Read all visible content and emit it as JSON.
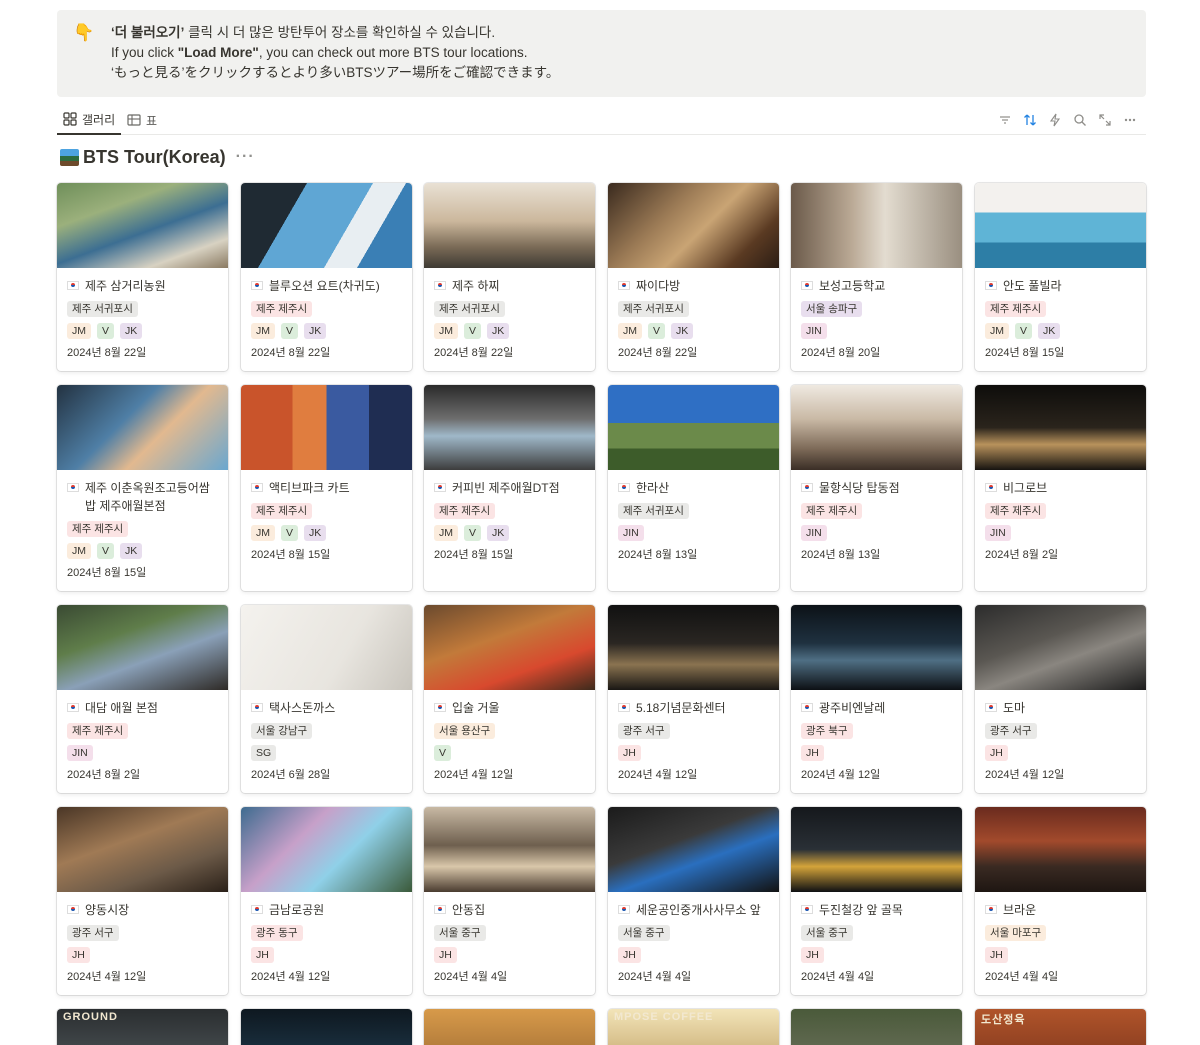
{
  "callout": {
    "icon": "👇",
    "line1_strong": "‘더 불러오기’",
    "line1_rest": " 클릭 시 더 많은 방탄투어 장소를 확인하실 수 있습니다.",
    "line2_pre": "If you click ",
    "line2_strong": "\"Load More\"",
    "line2_post": ", you can check out more BTS tour locations.",
    "line3": "‘もっと見る’をクリックするとより多いBTSツアー場所をご確認できます。"
  },
  "tabs": [
    {
      "label": "갤러리",
      "icon": "gallery-icon",
      "active": true
    },
    {
      "label": "표",
      "icon": "table-icon",
      "active": false
    }
  ],
  "toolbar": [
    "filter-icon",
    "sort-icon",
    "lightning-icon",
    "search-icon",
    "expand-icon",
    "more-icon"
  ],
  "database": {
    "title": "BTS Tour(Korea)",
    "more": "···",
    "accent": "#2383e2"
  },
  "tag_colors": {
    "red": "#fbe4e4",
    "gray": "#e9e9e7",
    "purple": "#e8deee",
    "orange": "#fbecdd",
    "green": "#dbeddb",
    "pink": "#f4dfeb",
    "yellow": "#fbf3db"
  },
  "cards": [
    {
      "title": "제주 삼거리농원",
      "region": "제주 서귀포시",
      "region_color": "gray",
      "members": [
        "JM",
        "V",
        "JK"
      ],
      "date": "2024년 8월 22일"
    },
    {
      "title": "블루오션 요트(차귀도)",
      "region": "제주 제주시",
      "region_color": "red",
      "members": [
        "JM",
        "V",
        "JK"
      ],
      "date": "2024년 8월 22일"
    },
    {
      "title": "제주 하찌",
      "region": "제주 서귀포시",
      "region_color": "gray",
      "members": [
        "JM",
        "V",
        "JK"
      ],
      "date": "2024년 8월 22일"
    },
    {
      "title": "짜이다방",
      "region": "제주 서귀포시",
      "region_color": "gray",
      "members": [
        "JM",
        "V",
        "JK"
      ],
      "date": "2024년 8월 22일"
    },
    {
      "title": "보성고등학교",
      "region": "서울 송파구",
      "region_color": "purple",
      "members": [
        "JIN"
      ],
      "date": "2024년 8월 20일"
    },
    {
      "title": "안도 풀빌라",
      "region": "제주 제주시",
      "region_color": "red",
      "members": [
        "JM",
        "V",
        "JK"
      ],
      "date": "2024년 8월 15일"
    },
    {
      "title": "제주 이춘옥원조고등어쌈밥 제주애월본점",
      "region": "제주 제주시",
      "region_color": "red",
      "members": [
        "JM",
        "V",
        "JK"
      ],
      "date": "2024년 8월 15일"
    },
    {
      "title": "액티브파크 카트",
      "region": "제주 제주시",
      "region_color": "red",
      "members": [
        "JM",
        "V",
        "JK"
      ],
      "date": "2024년 8월 15일"
    },
    {
      "title": "커피빈 제주애월DT점",
      "region": "제주 제주시",
      "region_color": "red",
      "members": [
        "JM",
        "V",
        "JK"
      ],
      "date": "2024년 8월 15일"
    },
    {
      "title": "한라산",
      "region": "제주 서귀포시",
      "region_color": "gray",
      "members": [
        "JIN"
      ],
      "date": "2024년 8월 13일"
    },
    {
      "title": "물항식당 탑동점",
      "region": "제주 제주시",
      "region_color": "red",
      "members": [
        "JIN"
      ],
      "date": "2024년 8월 13일"
    },
    {
      "title": "비그로브",
      "region": "제주 제주시",
      "region_color": "red",
      "members": [
        "JIN"
      ],
      "date": "2024년 8월 2일"
    },
    {
      "title": "대담 애월 본점",
      "region": "제주 제주시",
      "region_color": "red",
      "members": [
        "JIN"
      ],
      "date": "2024년 8월 2일"
    },
    {
      "title": "택사스돈까스",
      "region": "서울 강남구",
      "region_color": "gray",
      "members": [
        "SG"
      ],
      "date": "2024년 6월 28일"
    },
    {
      "title": "입술 거울",
      "region": "서울 용산구",
      "region_color": "orange",
      "members": [
        "V"
      ],
      "date": "2024년 4월 12일"
    },
    {
      "title": "5.18기념문화센터",
      "region": "광주 서구",
      "region_color": "gray",
      "members": [
        "JH"
      ],
      "date": "2024년 4월 12일"
    },
    {
      "title": "광주비엔날레",
      "region": "광주 북구",
      "region_color": "red",
      "members": [
        "JH"
      ],
      "date": "2024년 4월 12일"
    },
    {
      "title": "도마",
      "region": "광주 서구",
      "region_color": "gray",
      "members": [
        "JH"
      ],
      "date": "2024년 4월 12일"
    },
    {
      "title": "양동시장",
      "region": "광주 서구",
      "region_color": "gray",
      "members": [
        "JH"
      ],
      "date": "2024년 4월 12일"
    },
    {
      "title": "금남로공원",
      "region": "광주 동구",
      "region_color": "red",
      "members": [
        "JH"
      ],
      "date": "2024년 4월 12일"
    },
    {
      "title": "안동집",
      "region": "서울 중구",
      "region_color": "gray",
      "members": [
        "JH"
      ],
      "date": "2024년 4월 4일"
    },
    {
      "title": "세운공인중개사사무소 앞",
      "region": "서울 중구",
      "region_color": "gray",
      "members": [
        "JH"
      ],
      "date": "2024년 4월 4일"
    },
    {
      "title": "두진철강 앞 골목",
      "region": "서울 중구",
      "region_color": "gray",
      "members": [
        "JH"
      ],
      "date": "2024년 4월 4일"
    },
    {
      "title": "브라운",
      "region": "서울 마포구",
      "region_color": "orange",
      "members": [
        "JH"
      ],
      "date": "2024년 4월 4일"
    }
  ],
  "member_colors": {
    "JM": "orange",
    "V": "green",
    "JK": "purple",
    "JIN": "pink",
    "SG": "gray",
    "JH": "red"
  },
  "partial_row_texts": [
    "GROUND",
    "",
    "",
    "MPOSE COFFEE",
    "",
    "도산정육"
  ]
}
